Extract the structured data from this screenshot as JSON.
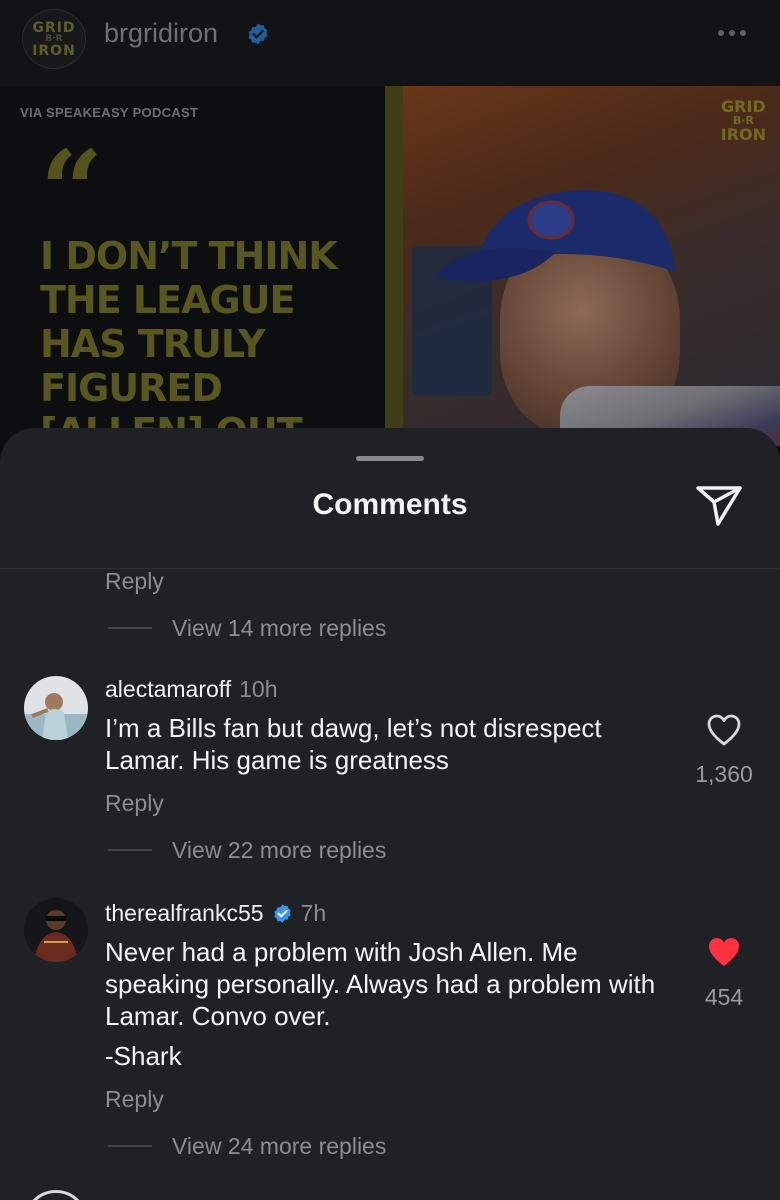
{
  "post": {
    "username": "brgridiron",
    "logo_lines": [
      "GRID",
      "B·R",
      "IRON"
    ],
    "image": {
      "source_text": "VIA SPEAKEASY PODCAST",
      "quote_mark": "“",
      "quote_text": "I DON’T THINK THE LEAGUE HAS TRULY FIGURED [ALLEN] OUT",
      "corner_logo_lines": [
        "GRID",
        "B·R",
        "IRON"
      ]
    }
  },
  "sheet": {
    "title": "Comments"
  },
  "thread": {
    "top_reply_label": "Reply",
    "top_view_replies": "View 14 more replies",
    "comments": [
      {
        "username": "alectamaroff",
        "time": "10h",
        "verified": false,
        "text": "I’m a Bills fan but dawg, let’s not disrespect Lamar. His game is greatness",
        "reply_label": "Reply",
        "view_replies": "View 22 more replies",
        "likes": "1,360",
        "liked": false
      },
      {
        "username": "therealfrankc55",
        "time": "7h",
        "verified": true,
        "text": "Never had a problem with Josh Allen. Me speaking personally. Always had a problem with Lamar. Convo over.",
        "signoff": "-Shark",
        "reply_label": "Reply",
        "view_replies": "View 24 more replies",
        "likes": "454",
        "liked": true
      }
    ]
  },
  "colors": {
    "verified_blue": "#3897f0",
    "like_red": "#ff3040",
    "sheet_bg": "#1f2124"
  }
}
